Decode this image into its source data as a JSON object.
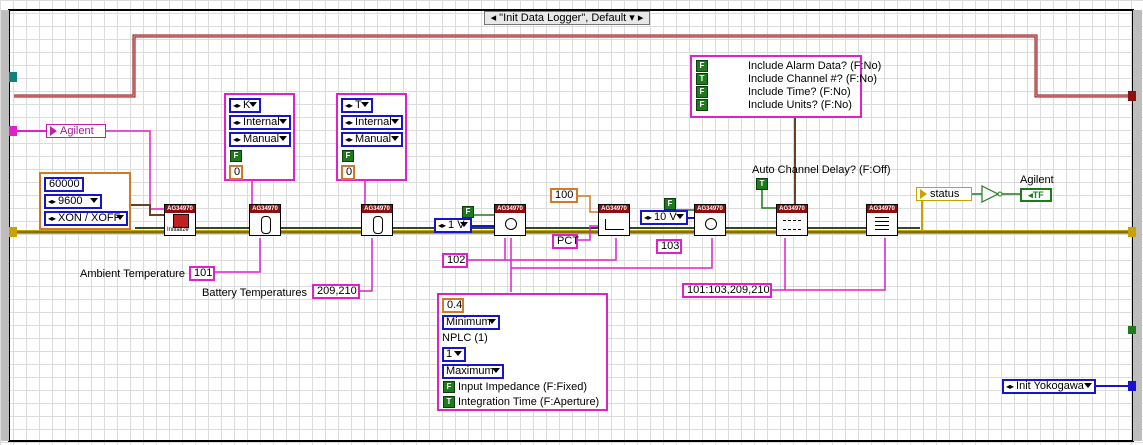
{
  "case_selector": {
    "label": "\"Init Data Logger\", Default"
  },
  "inputs": {
    "agilent_string": "Agilent",
    "serial_timeout": "60000",
    "baud_rate": "9600",
    "flow_control": "XON / XOFF"
  },
  "thermo_cluster_1": {
    "type": "K",
    "ref": "Internal",
    "mode": "Manual",
    "bool": "F",
    "num": "0"
  },
  "thermo_cluster_2": {
    "type": "T",
    "ref": "Internal",
    "mode": "Manual",
    "bool": "F",
    "num": "0"
  },
  "labels": {
    "ambient_temperature": "Ambient Temperature",
    "battery_temperatures": "Battery Temperatures",
    "auto_channel_delay": "Auto Channel Delay? (F:Off)",
    "agilent_indicator": "Agilent",
    "nplc": "NPLC (1)"
  },
  "constants": {
    "ambient_channel": "101",
    "battery_channels": "209,210",
    "range_1v": "1 V",
    "range_10v": "10 V",
    "ch_102": "102",
    "ch_103": "103",
    "hundred": "100",
    "pct": "PCT",
    "scan_list": "101:103,209,210",
    "status": "status",
    "tf": "TF",
    "bool_t": "T",
    "bool_f": "F"
  },
  "options_cluster": {
    "items": [
      {
        "bool": "F",
        "label": "Include Alarm Data? (F:No)"
      },
      {
        "bool": "T",
        "label": "Include Channel #? (F:No)"
      },
      {
        "bool": "F",
        "label": "Include Time? (F:No)"
      },
      {
        "bool": "F",
        "label": "Include Units? (F:No)"
      }
    ]
  },
  "voltage_cluster": {
    "value": "0.4",
    "min_sel": "Minimum",
    "nplc_label": "NPLC (1)",
    "nplc_sel": "1",
    "max_sel": "Maximum",
    "input_impedance": {
      "bool": "F",
      "label": "Input Impedance (F:Fixed)"
    },
    "integration_time": {
      "bool": "T",
      "label": "Integration Time (F:Aperture)"
    }
  },
  "next_case": {
    "label": "Init Yokogawa"
  },
  "vi_icons": {
    "header": "AG34970",
    "init": "Initialize"
  },
  "colors": {
    "string_wire": "#e020c8",
    "error_wire": "#c8a200",
    "case_border": "#000000",
    "frame_red": "#8b1010",
    "numeric_blue": "#1616c8",
    "bool_green": "#1d7a1d"
  }
}
